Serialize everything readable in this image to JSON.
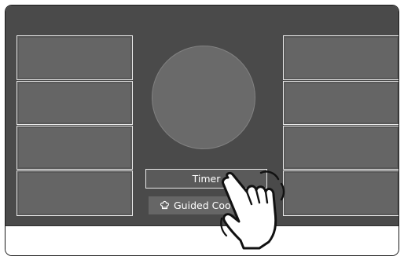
{
  "control_panel": {
    "center": {
      "timer_label": "Timer",
      "guided_cooking_label": "Guided Coo",
      "guided_cooking_icon": "chef-hat-icon"
    },
    "gesture_icon": "pointing-hand-icon"
  },
  "colors": {
    "screen_background": "#4a4a4a",
    "tile_fill": "#656565",
    "tile_border": "#e8e8e8",
    "dial_fill": "#6a6a6a",
    "text": "#ffffff"
  }
}
